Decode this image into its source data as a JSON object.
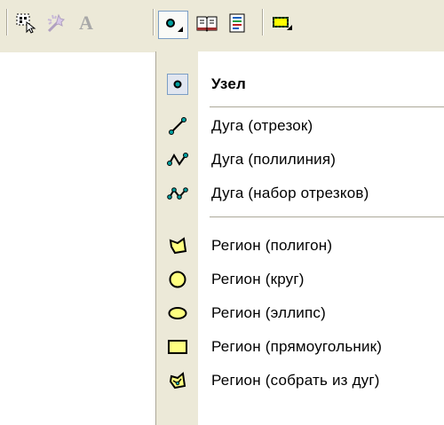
{
  "toolbar": {
    "buttons": [
      {
        "name": "select-tool-icon",
        "pressed": false
      },
      {
        "name": "magic-wand-icon",
        "pressed": false
      },
      {
        "name": "text-tool-icon",
        "pressed": false
      },
      {
        "name": "node-dropdown-icon",
        "pressed": true
      },
      {
        "name": "book-icon",
        "pressed": false
      },
      {
        "name": "document-icon",
        "pressed": false
      },
      {
        "name": "region-fill-icon",
        "pressed": false
      }
    ],
    "text_tool_glyph": "A"
  },
  "menu": {
    "items": [
      {
        "label": "Узел",
        "icon": "node-icon",
        "checked": true
      },
      {
        "label": "Дуга (отрезок)",
        "icon": "arc-segment-icon"
      },
      {
        "label": "Дуга (полилиния)",
        "icon": "arc-polyline-icon"
      },
      {
        "label": "Дуга (набор отрезков)",
        "icon": "arc-segment-set-icon"
      },
      {
        "label": "Регион (полигон)",
        "icon": "region-polygon-icon"
      },
      {
        "label": "Регион (круг)",
        "icon": "region-circle-icon"
      },
      {
        "label": "Регион (эллипс)",
        "icon": "region-ellipse-icon"
      },
      {
        "label": "Регион (прямоугольник)",
        "icon": "region-rectangle-icon"
      },
      {
        "label": "Регион (собрать из дуг)",
        "icon": "region-from-arcs-icon"
      }
    ]
  },
  "colors": {
    "toolbar_bg": "#ece9d8",
    "menu_strip": "#ece9d8",
    "icon_outline": "#000000",
    "icon_fill_yellow": "#ffff80",
    "icon_node": "#00a0a0"
  }
}
